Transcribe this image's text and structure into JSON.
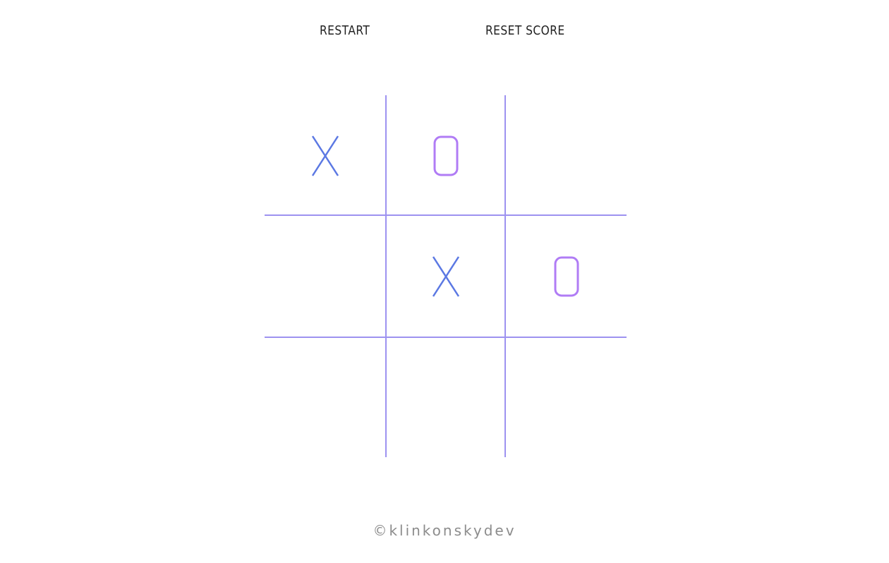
{
  "controls": {
    "restart_label": "RESTART",
    "reset_score_label": "RESET SCORE"
  },
  "colors": {
    "grid": "#9d92f0",
    "x": "#5b78e3",
    "o": "#b07cf5",
    "text": "#222222",
    "footer": "#8c8c8c"
  },
  "board": [
    [
      "X",
      "O",
      ""
    ],
    [
      "",
      "X",
      "O"
    ],
    [
      "",
      "",
      ""
    ]
  ],
  "footer": {
    "credit": "©klinkonskydev"
  }
}
